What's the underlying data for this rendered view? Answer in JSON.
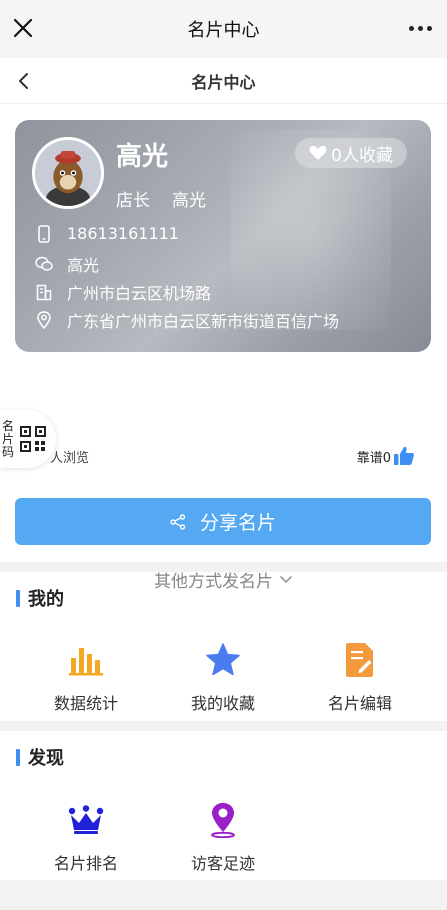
{
  "wechat_bar": {
    "title": "名片中心"
  },
  "nav": {
    "title": "名片中心"
  },
  "card": {
    "name": "高光",
    "favorites": "0人收藏",
    "role": "店长",
    "role_name": "高光",
    "phone": "18613161111",
    "wechat": "高光",
    "company_address": "广州市白云区机场路",
    "location": "广东省广州市白云区新市街道百信广场"
  },
  "qr_tab": {
    "label": "名片码"
  },
  "stats": {
    "visits": "人浏览",
    "likes": "靠谱0"
  },
  "share_button": {
    "label": "分享名片"
  },
  "other_ways": {
    "label": "其他方式发名片"
  },
  "mine": {
    "title": "我的",
    "items": [
      {
        "label": "数据统计",
        "icon": "bar-chart-icon"
      },
      {
        "label": "我的收藏",
        "icon": "star-icon"
      },
      {
        "label": "名片编辑",
        "icon": "edit-document-icon"
      }
    ]
  },
  "discover": {
    "title": "发现",
    "items": [
      {
        "label": "名片排名",
        "icon": "crown-icon"
      },
      {
        "label": "访客足迹",
        "icon": "location-pin-icon"
      }
    ]
  },
  "colors": {
    "accent": "#55a9f3",
    "section_bar": "#3d8ff2",
    "chart_orange": "#f5a623",
    "star_blue": "#4a7cf0",
    "edit_orange": "#f39a3c",
    "crown_blue": "#1f22d6",
    "pin_purple": "#9a1fc9"
  }
}
